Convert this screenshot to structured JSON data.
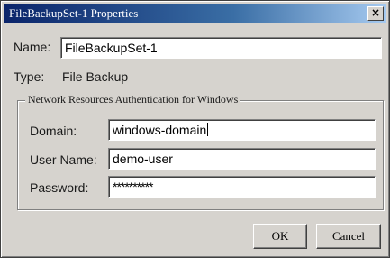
{
  "window": {
    "title": "FileBackupSet-1 Properties",
    "close_glyph": "×"
  },
  "name": {
    "label": "Name:",
    "value": "FileBackupSet-1"
  },
  "type": {
    "label": "Type:",
    "value": "File Backup"
  },
  "auth_group": {
    "title": "Network Resources Authentication for Windows",
    "domain": {
      "label": "Domain:",
      "value": "windows-domain"
    },
    "username": {
      "label": "User Name:",
      "value": "demo-user"
    },
    "password": {
      "label": "Password:",
      "value": "**********"
    }
  },
  "buttons": {
    "ok": "OK",
    "cancel": "Cancel"
  }
}
